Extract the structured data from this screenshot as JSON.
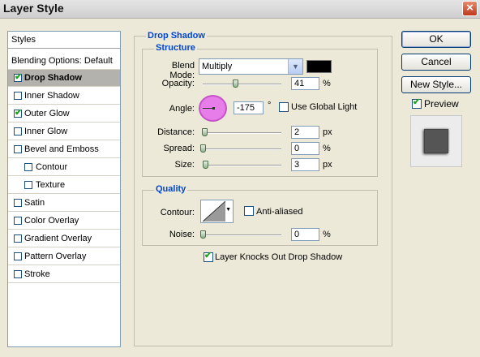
{
  "window": {
    "title": "Layer Style",
    "close_icon": "×"
  },
  "sidebar": {
    "header": "Styles",
    "items": [
      {
        "label": "Blending Options: Default",
        "checkbox": false,
        "checked": false,
        "selected": false,
        "indent": 0
      },
      {
        "label": "Drop Shadow",
        "checkbox": true,
        "checked": true,
        "selected": true,
        "indent": 0
      },
      {
        "label": "Inner Shadow",
        "checkbox": true,
        "checked": false,
        "selected": false,
        "indent": 0
      },
      {
        "label": "Outer Glow",
        "checkbox": true,
        "checked": true,
        "selected": false,
        "indent": 0
      },
      {
        "label": "Inner Glow",
        "checkbox": true,
        "checked": false,
        "selected": false,
        "indent": 0
      },
      {
        "label": "Bevel and Emboss",
        "checkbox": true,
        "checked": false,
        "selected": false,
        "indent": 0
      },
      {
        "label": "Contour",
        "checkbox": true,
        "checked": false,
        "selected": false,
        "indent": 1
      },
      {
        "label": "Texture",
        "checkbox": true,
        "checked": false,
        "selected": false,
        "indent": 1
      },
      {
        "label": "Satin",
        "checkbox": true,
        "checked": false,
        "selected": false,
        "indent": 0
      },
      {
        "label": "Color Overlay",
        "checkbox": true,
        "checked": false,
        "selected": false,
        "indent": 0
      },
      {
        "label": "Gradient Overlay",
        "checkbox": true,
        "checked": false,
        "selected": false,
        "indent": 0
      },
      {
        "label": "Pattern Overlay",
        "checkbox": true,
        "checked": false,
        "selected": false,
        "indent": 0
      },
      {
        "label": "Stroke",
        "checkbox": true,
        "checked": false,
        "selected": false,
        "indent": 0
      }
    ]
  },
  "drop_shadow": {
    "title": "Drop Shadow",
    "structure": {
      "title": "Structure",
      "blend_mode_label": "Blend Mode:",
      "blend_mode_value": "Multiply",
      "shadow_color": "#000000",
      "opacity_label": "Opacity:",
      "opacity_value": "41",
      "opacity_unit": "%",
      "angle_label": "Angle:",
      "angle_value": "-175",
      "angle_unit": "°",
      "use_global_light_label": "Use Global Light",
      "use_global_light_checked": false,
      "distance_label": "Distance:",
      "distance_value": "2",
      "distance_unit": "px",
      "spread_label": "Spread:",
      "spread_value": "0",
      "spread_unit": "%",
      "size_label": "Size:",
      "size_value": "3",
      "size_unit": "px"
    },
    "quality": {
      "title": "Quality",
      "contour_label": "Contour:",
      "anti_aliased_label": "Anti-aliased",
      "anti_aliased_checked": false,
      "noise_label": "Noise:",
      "noise_value": "0",
      "noise_unit": "%"
    },
    "knockout_label": "Layer Knocks Out Drop Shadow",
    "knockout_checked": true
  },
  "buttons": {
    "ok": "OK",
    "cancel": "Cancel",
    "new_style": "New Style...",
    "preview_label": "Preview",
    "preview_checked": true
  },
  "colors": {
    "accent_blue": "#0046d5",
    "selection_gray": "#b4b2ac",
    "angle_wheel": "#e67de8",
    "check_green": "#21a121"
  }
}
